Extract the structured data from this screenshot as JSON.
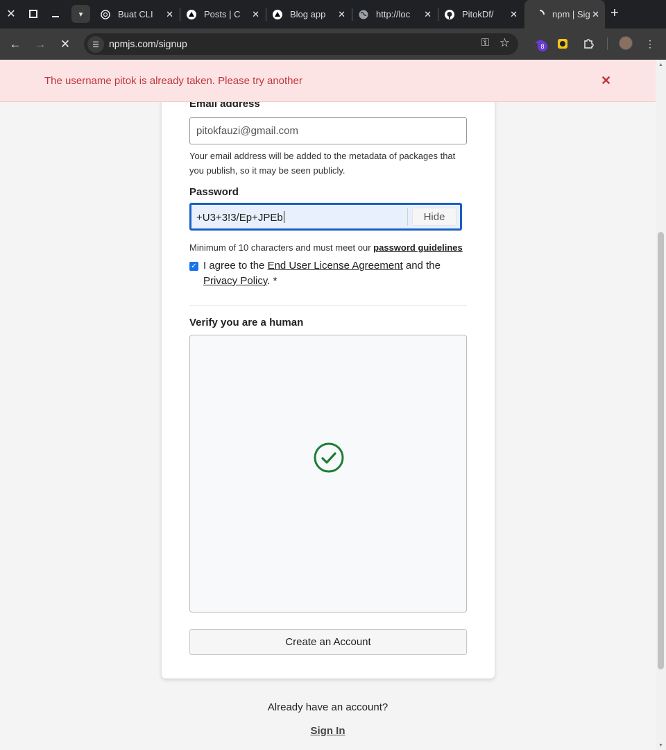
{
  "browser": {
    "tabs": [
      {
        "title": "Buat CLI",
        "icon": "chatgpt-icon"
      },
      {
        "title": "Posts | C",
        "icon": "triangle-icon"
      },
      {
        "title": "Blog app",
        "icon": "triangle-icon"
      },
      {
        "title": "http://loc",
        "icon": "globe-icon"
      },
      {
        "title": "PitokDf/",
        "icon": "github-icon"
      },
      {
        "title": "npm | Sig",
        "icon": "loading-icon"
      }
    ],
    "url": "npmjs.com/signup",
    "extension_badge": "8"
  },
  "alert": {
    "message": "The username pitok is already taken. Please try another"
  },
  "form": {
    "email_label": "Email address",
    "email_value": "pitokfauzi@gmail.com",
    "email_help": "Your email address will be added to the metadata of packages that you publish, so it may be seen publicly.",
    "password_label": "Password",
    "password_value": "+U3+3!3/Ep+JPEb",
    "hide_label": "Hide",
    "password_help_prefix": "Minimum of 10 characters and must meet our ",
    "password_help_link": "password guidelines",
    "agree_prefix": "I agree to the ",
    "eula_link": "End User License Agreement",
    "agree_middle": " and the ",
    "privacy_link": "Privacy Policy",
    "agree_suffix": ". *",
    "verify_label": "Verify you are a human",
    "create_button": "Create an Account"
  },
  "footer": {
    "have_account": "Already have an account?",
    "sign_in": "Sign In"
  },
  "colors": {
    "alert_bg": "#fce4e4",
    "alert_text": "#c0343a",
    "focus_border": "#1a5fc2",
    "check_green": "#1e7e34"
  }
}
